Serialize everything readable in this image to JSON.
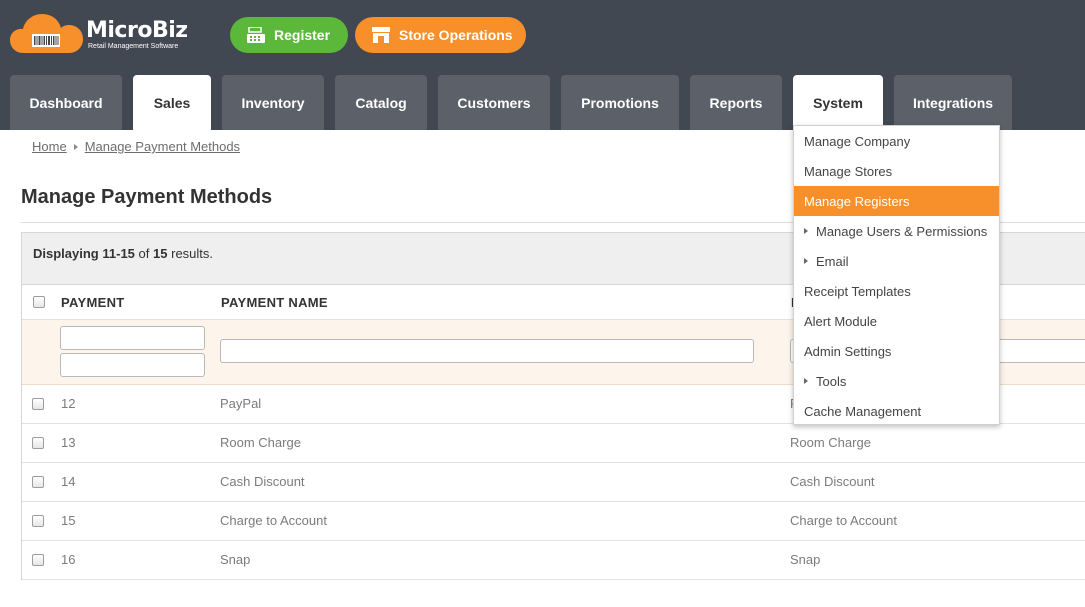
{
  "app": {
    "logo_name": "MicroBiz",
    "logo_tagline": "Retail Management Software",
    "colors": {
      "header": "#424852",
      "tab": "#5b6069",
      "accent_orange": "#f7902b",
      "accent_green": "#5cb83a"
    }
  },
  "header_buttons": {
    "register": {
      "label": "Register",
      "icon": "cash-register-icon"
    },
    "store_operations": {
      "label": "Store Operations",
      "icon": "storefront-icon"
    }
  },
  "tabs": [
    {
      "label": "Dashboard"
    },
    {
      "label": "Sales",
      "active": true
    },
    {
      "label": "Inventory"
    },
    {
      "label": "Catalog"
    },
    {
      "label": "Customers"
    },
    {
      "label": "Promotions"
    },
    {
      "label": "Reports"
    },
    {
      "label": "System",
      "active": true
    },
    {
      "label": "Integrations"
    }
  ],
  "breadcrumb": {
    "home": "Home",
    "current": "Manage Payment Methods"
  },
  "page": {
    "title": "Manage Payment Methods"
  },
  "grid": {
    "summary": {
      "prefix": "Displaying",
      "range": "11-15",
      "of": "of",
      "total": "15",
      "suffix": "results."
    },
    "columns": {
      "payment": "PAYMENT",
      "payment_name": "PAYMENT NAME",
      "third": "R"
    },
    "rows": [
      {
        "id": "12",
        "name": "PayPal",
        "third": "P"
      },
      {
        "id": "13",
        "name": "Room Charge",
        "third": "Room Charge"
      },
      {
        "id": "14",
        "name": "Cash Discount",
        "third": "Cash Discount"
      },
      {
        "id": "15",
        "name": "Charge to Account",
        "third": "Charge to Account"
      },
      {
        "id": "16",
        "name": "Snap",
        "third": "Snap"
      }
    ]
  },
  "system_menu": {
    "items": [
      {
        "label": "Manage Company"
      },
      {
        "label": "Manage Stores"
      },
      {
        "label": "Manage Registers",
        "highlighted": true
      },
      {
        "label": "Manage Users & Permissions",
        "submenu": true
      },
      {
        "label": "Email",
        "submenu": true
      },
      {
        "label": "Receipt Templates"
      },
      {
        "label": "Alert Module"
      },
      {
        "label": "Admin Settings"
      },
      {
        "label": "Tools",
        "submenu": true
      },
      {
        "label": "Cache Management"
      }
    ]
  }
}
